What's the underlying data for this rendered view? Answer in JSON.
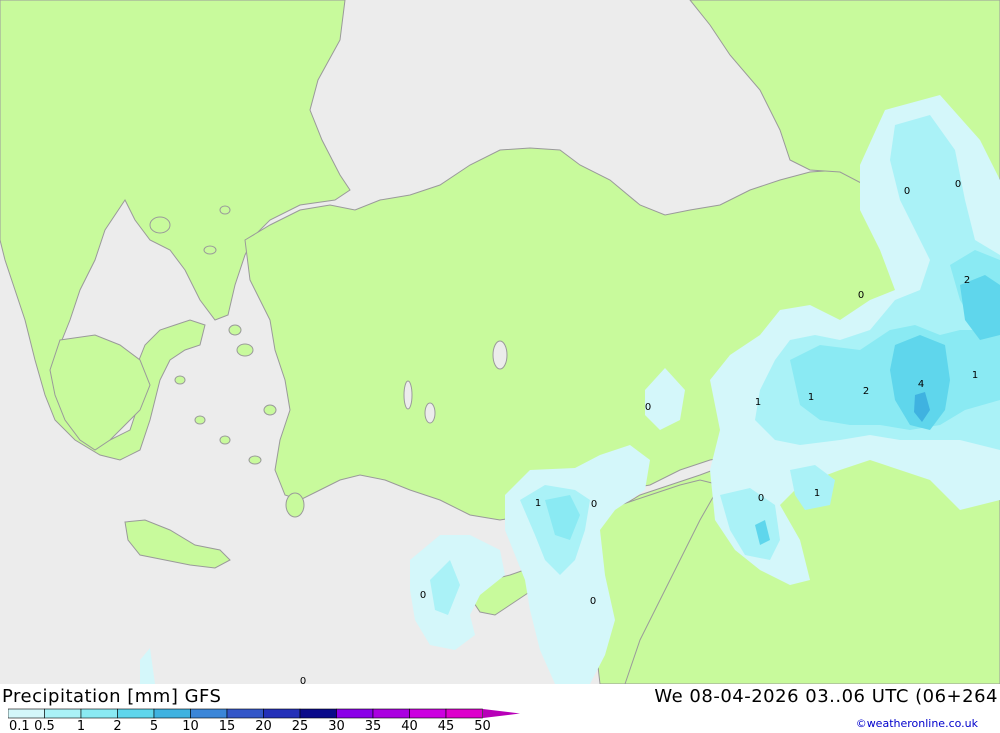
{
  "footer": {
    "title": "Precipitation [mm] GFS",
    "datetime": "We 08-04-2026 03..06 UTC (06+264",
    "credit": "©weatheronline.co.uk"
  },
  "legend": {
    "labels": [
      "0.1",
      "0.5",
      "1",
      "2",
      "5",
      "10",
      "15",
      "20",
      "25",
      "30",
      "35",
      "40",
      "45",
      "50"
    ],
    "colors": [
      "#d4f7fa",
      "#aaf2f7",
      "#8aeaf3",
      "#5fd6ec",
      "#3fb2e0",
      "#3b86d8",
      "#3356c8",
      "#2430b8",
      "#0a0a8a",
      "#8a00e8",
      "#aa00e0",
      "#cc00e0",
      "#dd00cc",
      "#b800b8"
    ]
  },
  "map": {
    "land_color": "#c8fa9c",
    "sea_color": "#ececec",
    "border_color": "#9a9a9a",
    "contour_labels": [
      "0",
      "0",
      "2",
      "0",
      "1",
      "1",
      "1",
      "2",
      "4",
      "0",
      "1",
      "0",
      "1",
      "0",
      "0",
      "0",
      "0"
    ]
  }
}
